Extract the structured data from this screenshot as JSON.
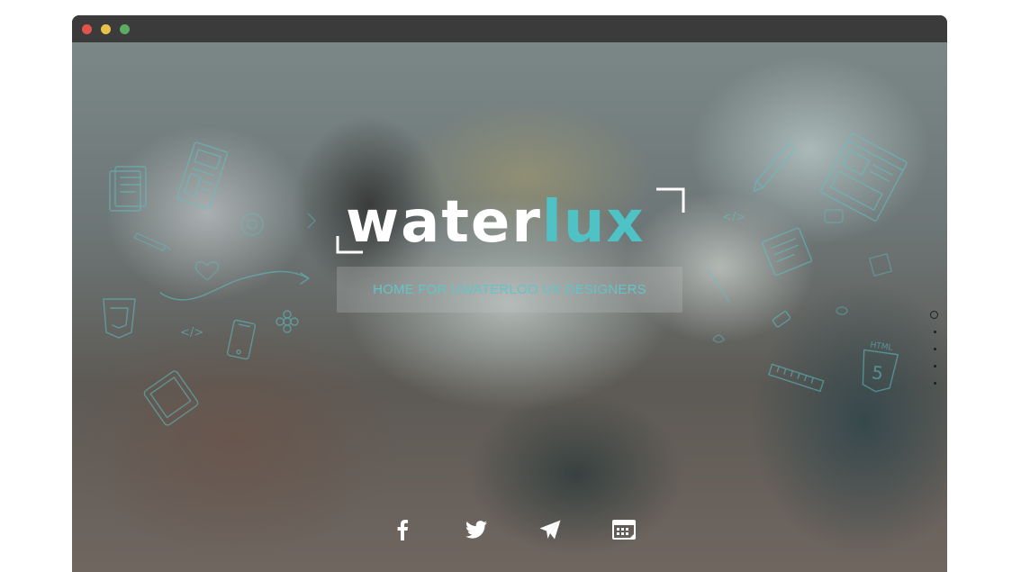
{
  "window": {
    "controls": {
      "close_color": "#e1544d",
      "minimize_color": "#e7c24a",
      "maximize_color": "#5dab61"
    }
  },
  "logo": {
    "part_white": "water",
    "part_teal": "lux",
    "colors": {
      "white": "#ffffff",
      "teal": "#4fc2c6"
    }
  },
  "tagline": "HOME FOR UWATERLOO UX DESIGNERS",
  "page_nav": {
    "count": 5,
    "active_index": 0
  },
  "social": [
    {
      "name": "facebook",
      "icon": "facebook-icon"
    },
    {
      "name": "twitter",
      "icon": "twitter-icon"
    },
    {
      "name": "telegram",
      "icon": "paper-plane-icon"
    },
    {
      "name": "calendar",
      "icon": "calendar-icon"
    }
  ],
  "doodle_glyphs": {
    "code_tag": "</>",
    "html5_label": "HTML",
    "html5_digit": "5"
  },
  "colors": {
    "accent": "#4fc2c6",
    "doodle": "#5fc3c8"
  }
}
